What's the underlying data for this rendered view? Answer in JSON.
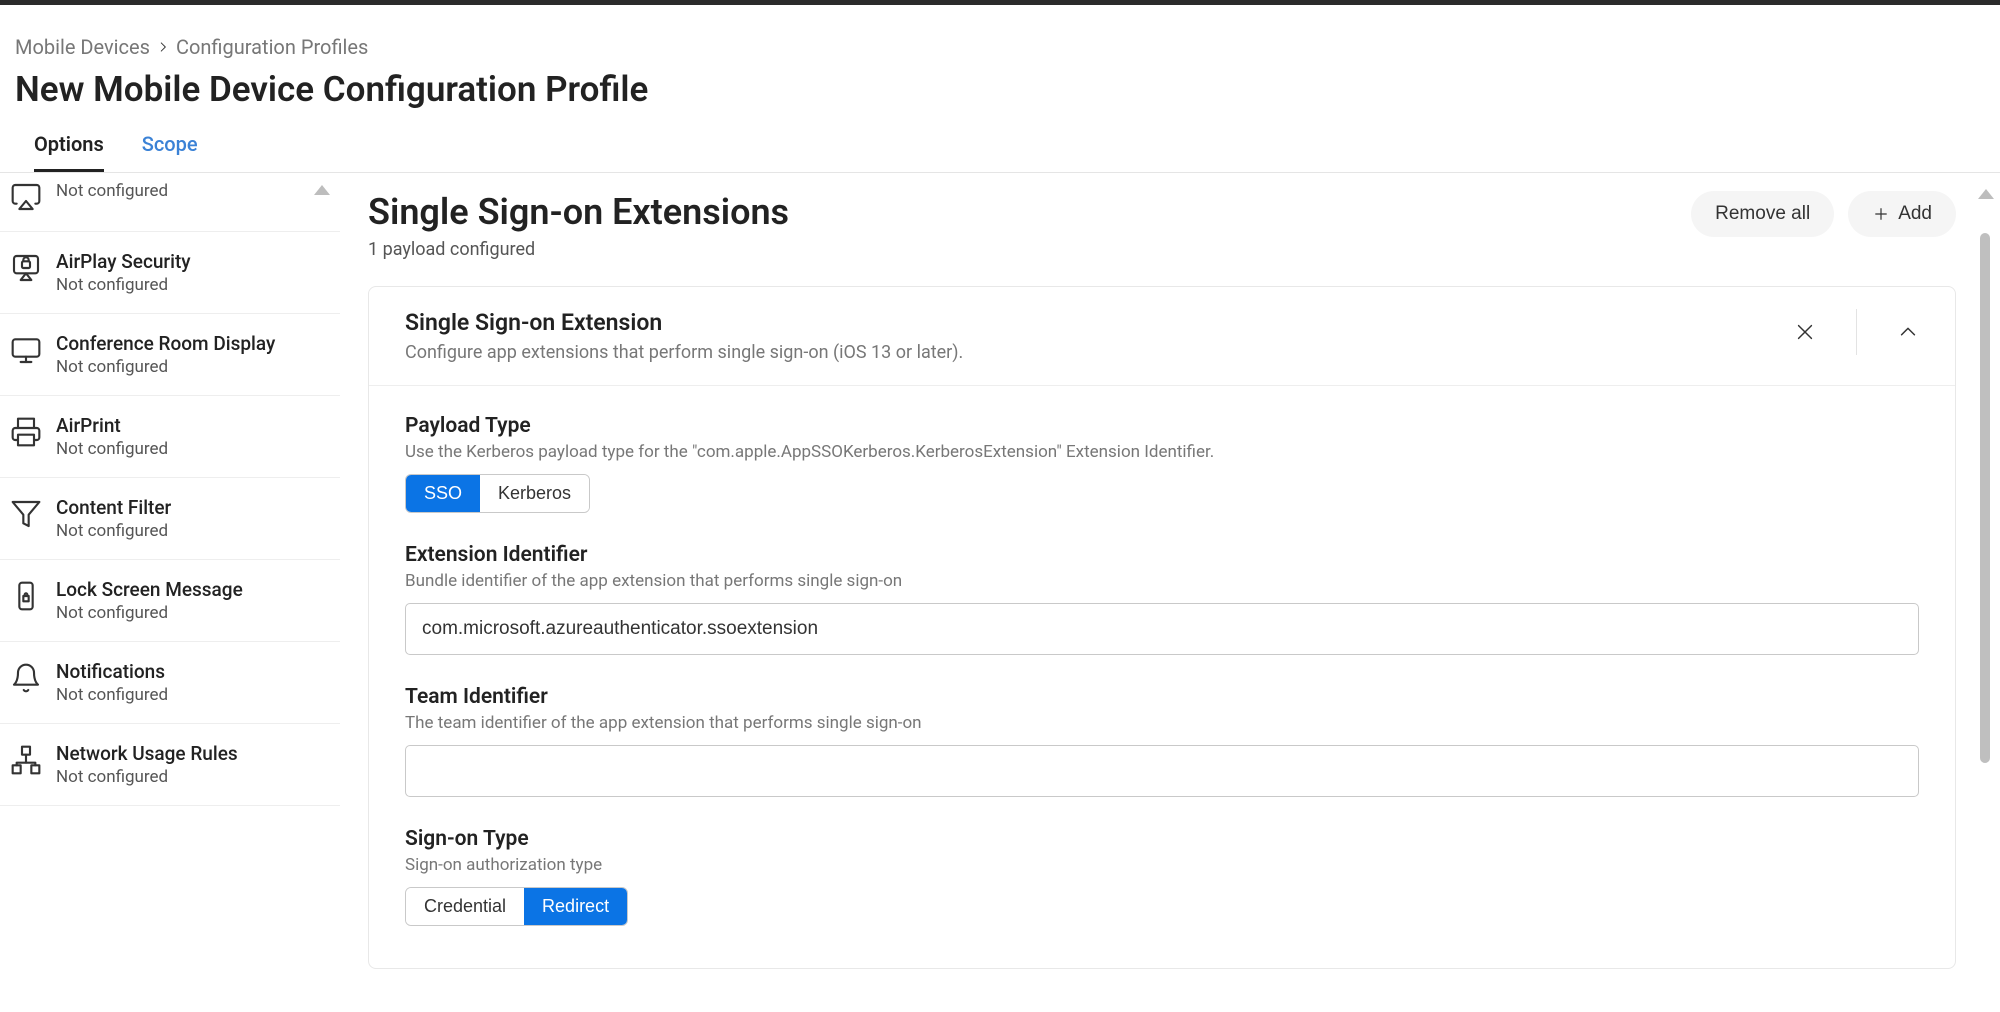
{
  "breadcrumb": {
    "part1": "Mobile Devices",
    "part2": "Configuration Profiles"
  },
  "page_title": "New Mobile Device Configuration Profile",
  "tabs": {
    "options": "Options",
    "scope": "Scope"
  },
  "sidebar": {
    "not_configured": "Not configured",
    "items": [
      {
        "label": ""
      },
      {
        "label": "AirPlay Security"
      },
      {
        "label": "Conference Room Display"
      },
      {
        "label": "AirPrint"
      },
      {
        "label": "Content Filter"
      },
      {
        "label": "Lock Screen Message"
      },
      {
        "label": "Notifications"
      },
      {
        "label": "Network Usage Rules"
      }
    ]
  },
  "panel": {
    "title": "Single Sign-on Extensions",
    "subtitle": "1 payload configured",
    "remove_all": "Remove all",
    "add": "Add"
  },
  "card": {
    "title": "Single Sign-on Extension",
    "desc": "Configure app extensions that perform single sign-on (iOS 13 or later)."
  },
  "fields": {
    "payload_type": {
      "title": "Payload Type",
      "desc": "Use the Kerberos payload type for the \"com.apple.AppSSOKerberos.KerberosExtension\" Extension Identifier.",
      "opt_sso": "SSO",
      "opt_kerberos": "Kerberos"
    },
    "ext_id": {
      "title": "Extension Identifier",
      "desc": "Bundle identifier of the app extension that performs single sign-on",
      "value": "com.microsoft.azureauthenticator.ssoextension"
    },
    "team_id": {
      "title": "Team Identifier",
      "desc": "The team identifier of the app extension that performs single sign-on",
      "value": ""
    },
    "signon_type": {
      "title": "Sign-on Type",
      "desc": "Sign-on authorization type",
      "opt_credential": "Credential",
      "opt_redirect": "Redirect"
    }
  }
}
